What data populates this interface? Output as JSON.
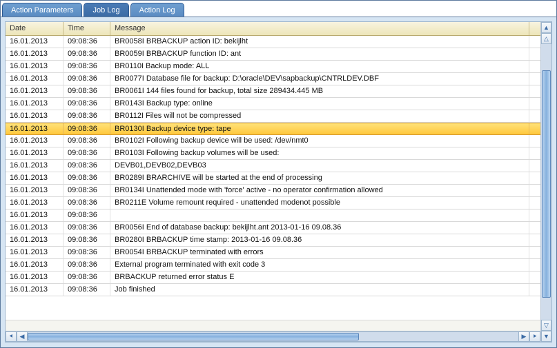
{
  "tabs": [
    {
      "label": "Action Parameters",
      "active": false
    },
    {
      "label": "Job Log",
      "active": true
    },
    {
      "label": "Action Log",
      "active": false
    }
  ],
  "columns": {
    "date": "Date",
    "time": "Time",
    "message": "Message"
  },
  "selected_index": 7,
  "rows": [
    {
      "date": "16.01.2013",
      "time": "09:08:36",
      "message": "BR0058I BRBACKUP action ID: bekijlht"
    },
    {
      "date": "16.01.2013",
      "time": "09:08:36",
      "message": "BR0059I BRBACKUP function ID: ant"
    },
    {
      "date": "16.01.2013",
      "time": "09:08:36",
      "message": "BR0110I Backup mode: ALL"
    },
    {
      "date": "16.01.2013",
      "time": "09:08:36",
      "message": "BR0077I Database file for backup: D:\\oracle\\DEV\\sapbackup\\CNTRLDEV.DBF"
    },
    {
      "date": "16.01.2013",
      "time": "09:08:36",
      "message": "BR0061I 144 files found for backup, total size 289434.445 MB"
    },
    {
      "date": "16.01.2013",
      "time": "09:08:36",
      "message": "BR0143I Backup type: online"
    },
    {
      "date": "16.01.2013",
      "time": "09:08:36",
      "message": "BR0112I Files will not be compressed"
    },
    {
      "date": "16.01.2013",
      "time": "09:08:36",
      "message": "BR0130I Backup device type: tape"
    },
    {
      "date": "16.01.2013",
      "time": "09:08:36",
      "message": "BR0102I Following backup device will be used: /dev/nmt0"
    },
    {
      "date": "16.01.2013",
      "time": "09:08:36",
      "message": "BR0103I Following backup volumes will be used:"
    },
    {
      "date": "16.01.2013",
      "time": "09:08:36",
      "message": "DEVB01,DEVB02,DEVB03"
    },
    {
      "date": "16.01.2013",
      "time": "09:08:36",
      "message": "BR0289I BRARCHIVE will be started at the end of processing"
    },
    {
      "date": "16.01.2013",
      "time": "09:08:36",
      "message": "BR0134I Unattended mode with 'force' active - no operator confirmation allowed"
    },
    {
      "date": "16.01.2013",
      "time": "09:08:36",
      "message": "BR0211E Volume remount required - unattended modenot possible"
    },
    {
      "date": "16.01.2013",
      "time": "09:08:36",
      "message": ""
    },
    {
      "date": "16.01.2013",
      "time": "09:08:36",
      "message": "BR0056I End of database backup: bekijlht.ant 2013-01-16 09.08.36"
    },
    {
      "date": "16.01.2013",
      "time": "09:08:36",
      "message": "BR0280I BRBACKUP time stamp: 2013-01-16 09.08.36"
    },
    {
      "date": "16.01.2013",
      "time": "09:08:36",
      "message": "BR0054I BRBACKUP terminated with errors"
    },
    {
      "date": "16.01.2013",
      "time": "09:08:36",
      "message": "External program terminated with exit code 3"
    },
    {
      "date": "16.01.2013",
      "time": "09:08:36",
      "message": "BRBACKUP returned error status E"
    },
    {
      "date": "16.01.2013",
      "time": "09:08:36",
      "message": "Job finished"
    }
  ]
}
